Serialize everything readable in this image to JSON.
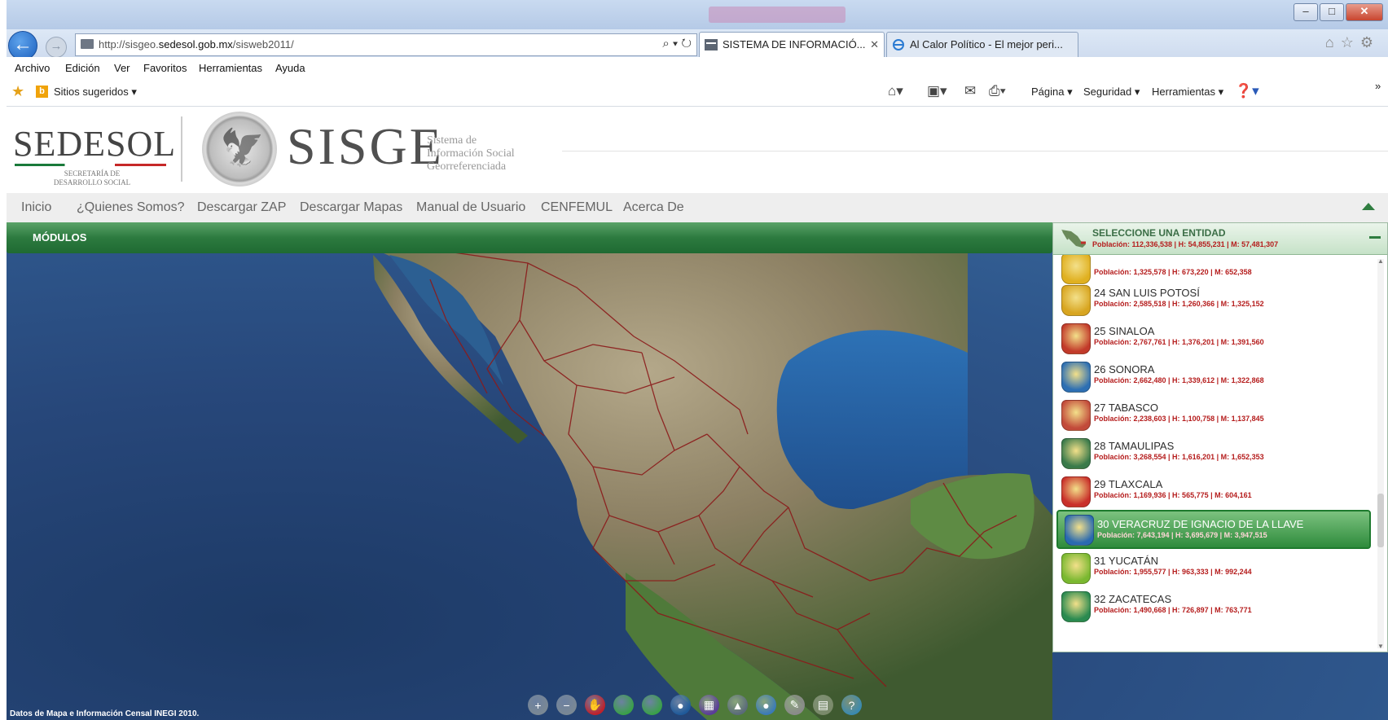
{
  "browser": {
    "address": {
      "url_prefix": "http://sisgeo.",
      "url_domain": "sedesol.gob.mx",
      "url_path": "/sisweb2011/"
    },
    "tabs": [
      {
        "label": "SISTEMA DE INFORMACIÓ...",
        "active": true
      },
      {
        "label": "Al Calor Político - El mejor peri...",
        "active": false
      }
    ],
    "menu": [
      "Archivo",
      "Edición",
      "Ver",
      "Favoritos",
      "Herramientas",
      "Ayuda"
    ],
    "favorites": {
      "suggested": "Sitios sugeridos ▾"
    },
    "commandbar": {
      "page": "Página ▾",
      "security": "Seguridad ▾",
      "tools": "Herramientas ▾",
      "more": "»"
    }
  },
  "header": {
    "logo": "SEDESOL",
    "logo_sub": "SECRETARÍA DE DESARROLLO SOCIAL",
    "app_title": "SISGE",
    "app_sub_1": "Sistema de",
    "app_sub_2": "Información Social",
    "app_sub_3": "Georreferenciada"
  },
  "sitenav": [
    "Inicio",
    "¿Quienes Somos?",
    "Descargar ZAP",
    "Descargar Mapas",
    "Manual de Usuario",
    "CENFEMUL",
    "Acerca De"
  ],
  "modules": {
    "label": "MÓDULOS"
  },
  "map": {
    "credit": "Datos de Mapa e Información Censal INEGI 2010."
  },
  "panel": {
    "title": "SELECCIONE UNA ENTIDAD",
    "summary": "Población: 112,336,538 | H: 54,855,231 | M: 57,481,307",
    "items": [
      {
        "name": "",
        "pop": "Población: 1,325,578 | H: 673,220 | M: 652,358",
        "color": "#e0b020"
      },
      {
        "name": "24 SAN LUIS POTOSÍ",
        "pop": "Población: 2,585,518 | H: 1,260,366 | M: 1,325,152",
        "color": "#d8a520"
      },
      {
        "name": "25 SINALOA",
        "pop": "Población: 2,767,761 | H: 1,376,201 | M: 1,391,560",
        "color": "#c23a2a"
      },
      {
        "name": "26 SONORA",
        "pop": "Población: 2,662,480 | H: 1,339,612 | M: 1,322,868",
        "color": "#2d6fb3"
      },
      {
        "name": "27 TABASCO",
        "pop": "Población: 2,238,603 | H: 1,100,758 | M: 1,137,845",
        "color": "#c24a3a"
      },
      {
        "name": "28 TAMAULIPAS",
        "pop": "Población: 3,268,554 | H: 1,616,201 | M: 1,652,353",
        "color": "#3a7a4a"
      },
      {
        "name": "29 TLAXCALA",
        "pop": "Población: 1,169,936 | H: 565,775 | M: 604,161",
        "color": "#c9302a"
      },
      {
        "name": "30 VERACRUZ DE IGNACIO DE LA LLAVE",
        "pop": "Población: 7,643,194 | H: 3,695,679 | M: 3,947,515",
        "color": "#2a6ab0",
        "selected": true
      },
      {
        "name": "31 YUCATÁN",
        "pop": "Población: 1,955,577 | H: 963,333 | M: 992,244",
        "color": "#7ab830"
      },
      {
        "name": "32 ZACATECAS",
        "pop": "Población: 1,490,668 | H: 726,897 | M: 763,771",
        "color": "#2a8a50"
      }
    ]
  },
  "map_tools": [
    {
      "icon": "zoom-in-icon",
      "glyph": "+",
      "color": "#7a8894"
    },
    {
      "icon": "zoom-out-icon",
      "glyph": "−",
      "color": "#7a8894"
    },
    {
      "icon": "pan-hand-icon",
      "glyph": "✋",
      "color": "#c0202a"
    },
    {
      "icon": "previous-extent-icon",
      "glyph": "",
      "color": "#3aa048"
    },
    {
      "icon": "next-extent-icon",
      "glyph": "",
      "color": "#3aa048"
    },
    {
      "icon": "full-extent-globe-icon",
      "glyph": "●",
      "color": "#1f5a9a"
    },
    {
      "icon": "chart-icon",
      "glyph": "▦",
      "color": "#5a3a9a"
    },
    {
      "icon": "measure-icon",
      "glyph": "▲",
      "color": "#5a6a7a"
    },
    {
      "icon": "identify-icon",
      "glyph": "●",
      "color": "#3a7ab8"
    },
    {
      "icon": "draw-icon",
      "glyph": "✎",
      "color": "#8a8a8a"
    },
    {
      "icon": "legend-icon",
      "glyph": "▤",
      "color": "#7a8a6a"
    },
    {
      "icon": "help-icon",
      "glyph": "?",
      "color": "#3a8ab0"
    }
  ]
}
